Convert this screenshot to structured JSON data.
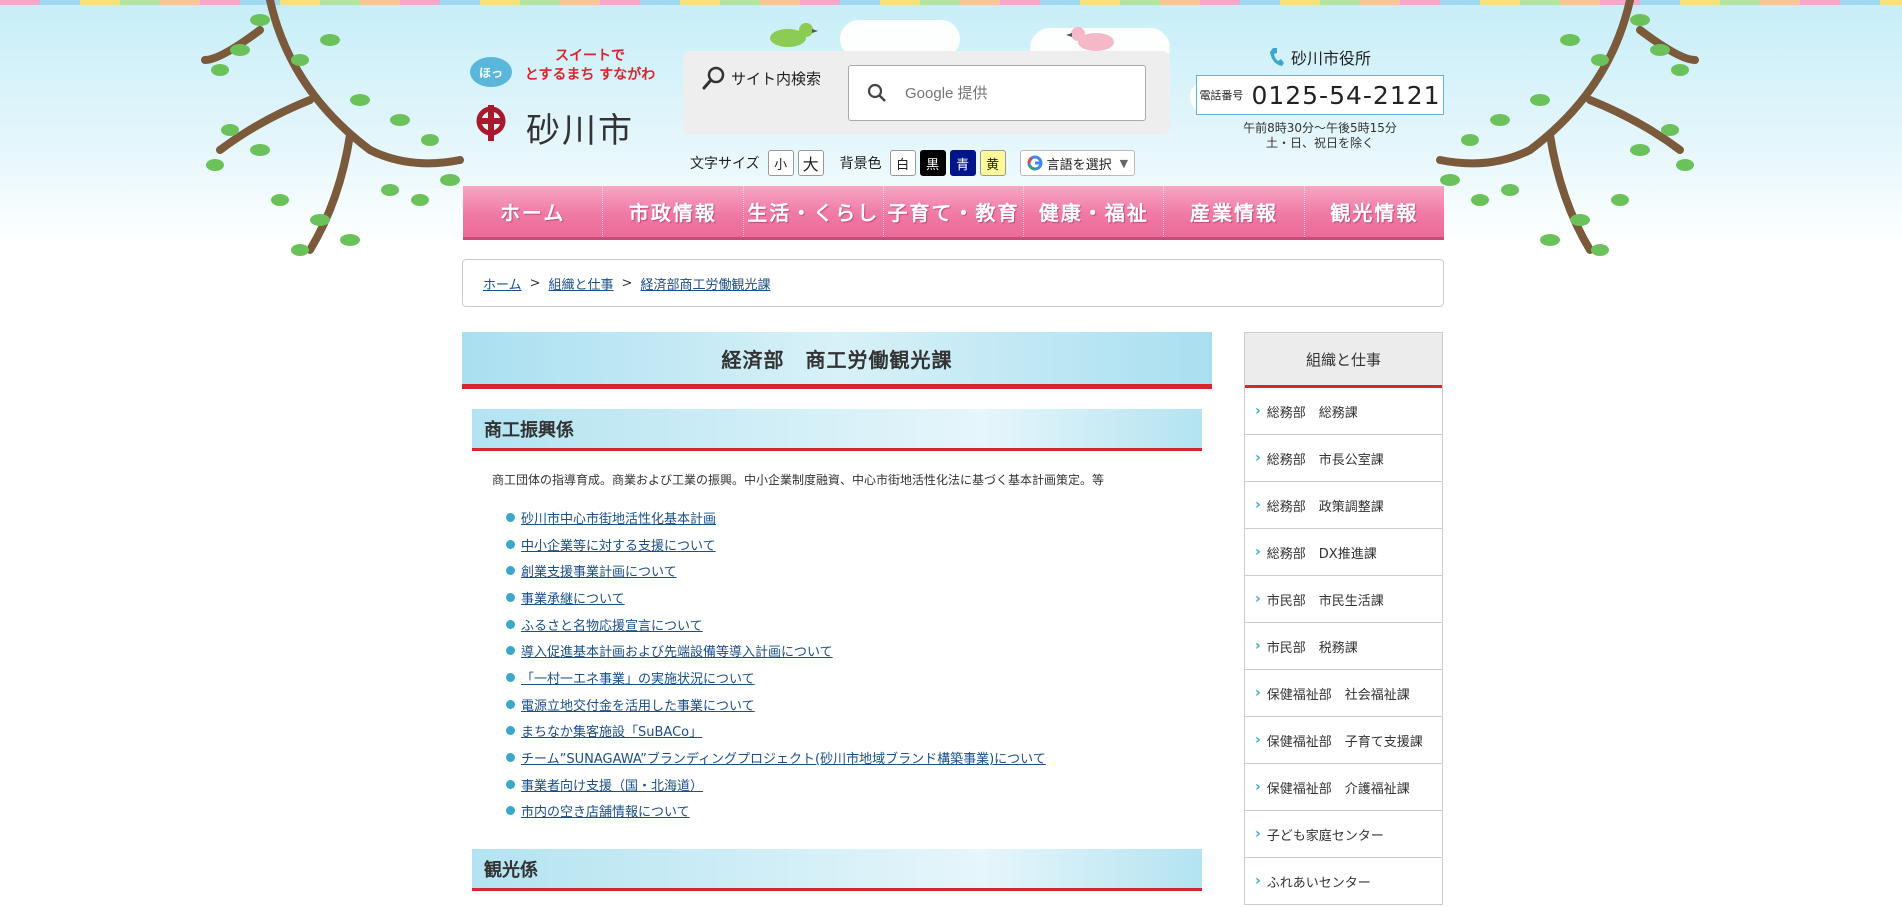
{
  "header": {
    "logo_bubble": "ほっ",
    "logo_tagline_1": "スイートで",
    "logo_tagline_2": "とするまち すながわ",
    "logo_name": "砂川市"
  },
  "search": {
    "label": "サイト内検索",
    "placeholder": "Google 提供"
  },
  "tools": {
    "font_size_label": "文字サイズ",
    "font_small": "小",
    "font_large": "大",
    "bg_label": "背景色",
    "bg_white": "白",
    "bg_black": "黒",
    "bg_blue": "青",
    "bg_yellow": "黄",
    "language": "言語を選択"
  },
  "contact": {
    "office": "砂川市役所",
    "phone_label": "電話番号",
    "phone": "0125-54-2121",
    "hours_1": "午前8時30分～午後5時15分",
    "hours_2": "土・日、祝日を除く"
  },
  "nav": [
    "ホーム",
    "市政情報",
    "生活・くらし",
    "子育て・教育",
    "健康・福祉",
    "産業情報",
    "観光情報"
  ],
  "breadcrumb": [
    "ホーム",
    "組織と仕事",
    "経済部商工労働観光課"
  ],
  "page_title": "経済部　商工労働観光課",
  "section1": {
    "title": "商工振興係",
    "description": "商工団体の指導育成。商業および工業の振興。中小企業制度融資、中心市街地活性化法に基づく基本計画策定。等",
    "links": [
      "砂川市中心市街地活性化基本計画",
      "中小企業等に対する支援について",
      "創業支援事業計画について",
      "事業承継について",
      "ふるさと名物応援宣言について",
      "導入促進基本計画および先端設備等導入計画について",
      "「一村一エネ事業」の実施状況について",
      "電源立地交付金を活用した事業について",
      "まちなか集客施設「SuBACo」",
      "チーム”SUNAGAWA”ブランディングプロジェクト(砂川市地域ブランド構築事業)について",
      "事業者向け支援（国・北海道）",
      "市内の空き店舗情報について"
    ]
  },
  "section2": {
    "title": "観光係"
  },
  "sidebar": {
    "title": "組織と仕事",
    "items": [
      "総務部　総務課",
      "総務部　市長公室課",
      "総務部　政策調整課",
      "総務部　DX推進課",
      "市民部　市民生活課",
      "市民部　税務課",
      "保健福祉部　社会福祉課",
      "保健福祉部　子育て支援課",
      "保健福祉部　介護福祉課",
      "子ども家庭センター",
      "ふれあいセンター"
    ]
  },
  "colors": {
    "nav_pink": "#f07aa5",
    "accent_red": "#d8262e",
    "section_blue": "#b3e3f1",
    "link_blue": "#1a4f8a"
  }
}
